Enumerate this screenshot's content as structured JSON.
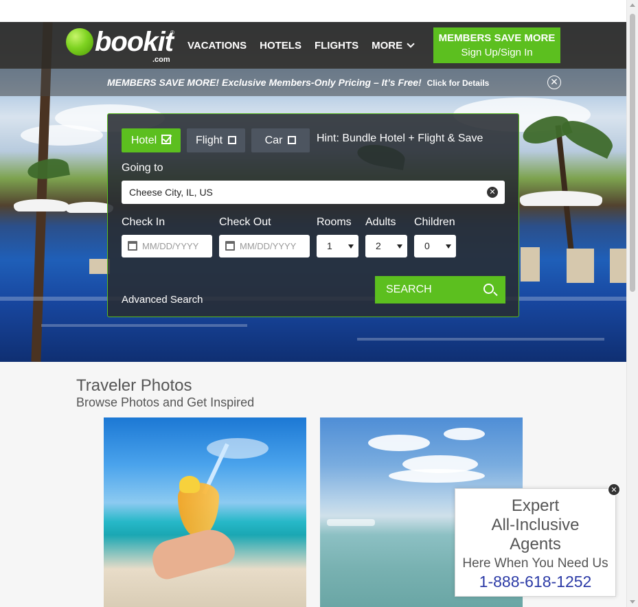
{
  "header": {
    "logo_text": "bookit",
    "logo_com": ".com",
    "logo_reg": "®",
    "nav": [
      {
        "label": "VACATIONS"
      },
      {
        "label": "HOTELS"
      },
      {
        "label": "FLIGHTS"
      },
      {
        "label": "MORE"
      }
    ],
    "members_button": {
      "line1": "MEMBERS SAVE MORE",
      "line2": "Sign Up/Sign In"
    }
  },
  "promo": {
    "text": "MEMBERS SAVE MORE! Exclusive Members-Only Pricing – It’s Free!",
    "link": "Click for Details",
    "close_glyph": "✕"
  },
  "search": {
    "tabs": [
      {
        "label": "Hotel",
        "selected": true
      },
      {
        "label": "Flight",
        "selected": false
      },
      {
        "label": "Car",
        "selected": false
      }
    ],
    "hint": "Hint: Bundle Hotel + Flight & Save",
    "going_to_label": "Going to",
    "destination_value": "Cheese City, IL, US",
    "clear_glyph": "✕",
    "check_in_label": "Check In",
    "check_out_label": "Check Out",
    "date_placeholder": "MM/DD/YYYY",
    "rooms_label": "Rooms",
    "adults_label": "Adults",
    "children_label": "Children",
    "rooms_value": "1",
    "adults_value": "2",
    "children_value": "0",
    "advanced_label": "Advanced Search",
    "search_label": "SEARCH"
  },
  "traveler_photos": {
    "title": "Traveler Photos",
    "subtitle": "Browse Photos and Get Inspired"
  },
  "chat": {
    "line1": "Expert",
    "line2": "All-Inclusive",
    "line3": "Agents",
    "subtitle": "Here When You Need Us",
    "phone": "1-888-618-1252",
    "close_glyph": "✕"
  },
  "colors": {
    "brand_green": "#5cbf1f",
    "phone_blue": "#2b3aa6"
  }
}
